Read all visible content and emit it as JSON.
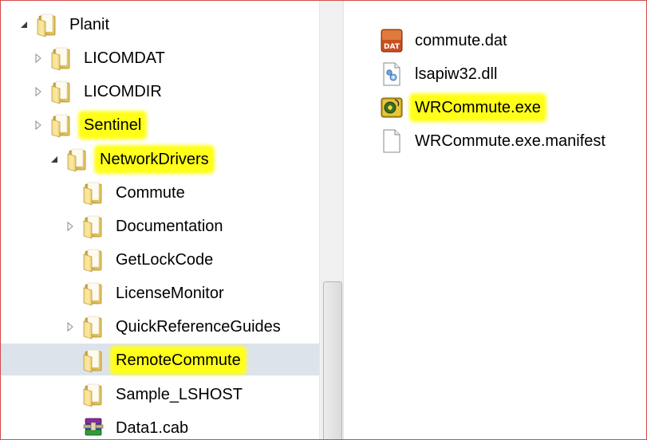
{
  "tree": {
    "items": [
      {
        "label": "Planit",
        "expander": "expanded",
        "highlight": false
      },
      {
        "label": "LICOMDAT",
        "expander": "collapsed",
        "highlight": false
      },
      {
        "label": "LICOMDIR",
        "expander": "collapsed",
        "highlight": false
      },
      {
        "label": "Sentinel",
        "expander": "collapsed",
        "highlight": true
      },
      {
        "label": "NetworkDrivers",
        "expander": "expanded",
        "highlight": true
      },
      {
        "label": "Commute",
        "expander": "none",
        "highlight": false
      },
      {
        "label": "Documentation",
        "expander": "collapsed",
        "highlight": false
      },
      {
        "label": "GetLockCode",
        "expander": "none",
        "highlight": false
      },
      {
        "label": "LicenseMonitor",
        "expander": "none",
        "highlight": false
      },
      {
        "label": "QuickReferenceGuides",
        "expander": "collapsed",
        "highlight": false
      },
      {
        "label": "RemoteCommute",
        "expander": "none",
        "highlight": true,
        "selected": true
      },
      {
        "label": "Sample_LSHOST",
        "expander": "none",
        "highlight": false
      },
      {
        "label": "Data1.cab",
        "expander": "none",
        "highlight": false,
        "icon": "winrar-archive-icon"
      }
    ]
  },
  "files": {
    "items": [
      {
        "label": "commute.dat",
        "icon": "dat-file-icon",
        "highlight": false
      },
      {
        "label": "lsapiw32.dll",
        "icon": "dll-file-icon",
        "highlight": false
      },
      {
        "label": "WRCommute.exe",
        "icon": "exe-app-icon",
        "highlight": true
      },
      {
        "label": "WRCommute.exe.manifest",
        "icon": "blank-file-icon",
        "highlight": false
      }
    ]
  },
  "colors": {
    "highlight": "#ffff1a",
    "selection": "#dde3ea",
    "frame_border": "#d24b4b"
  }
}
